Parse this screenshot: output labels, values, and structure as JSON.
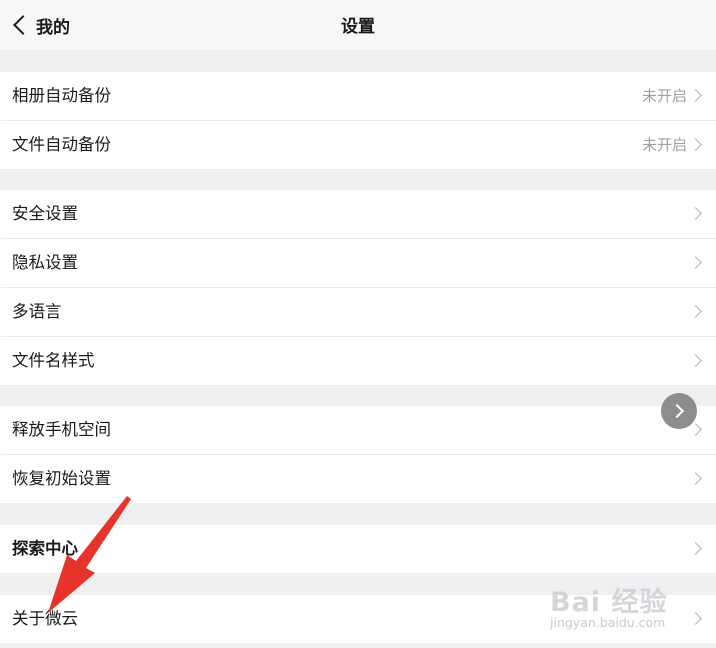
{
  "header": {
    "back_label": "我的",
    "title": "设置"
  },
  "sections": [
    {
      "rows": [
        {
          "label": "相册自动备份",
          "value": "未开启"
        },
        {
          "label": "文件自动备份",
          "value": "未开启"
        }
      ]
    },
    {
      "rows": [
        {
          "label": "安全设置"
        },
        {
          "label": "隐私设置"
        },
        {
          "label": "多语言"
        },
        {
          "label": "文件名样式"
        }
      ]
    },
    {
      "rows": [
        {
          "label": "释放手机空间"
        },
        {
          "label": "恢复初始设置"
        }
      ]
    },
    {
      "rows": [
        {
          "label": "探索中心"
        }
      ]
    },
    {
      "rows": [
        {
          "label": "关于微云"
        }
      ]
    }
  ],
  "watermark": {
    "logo": "Bai 经验",
    "url": "jingyan.baidu.com"
  },
  "colors": {
    "background": "#efeff1",
    "row_background": "#ffffff",
    "secondary_text": "#a0a0a6",
    "annotation_arrow": "#e8332a",
    "floating_button": "#8d8d8f"
  },
  "icons": [
    "back-chevron-icon",
    "chevron-right-icon",
    "floating-chevron-icon",
    "annotation-arrow"
  ]
}
